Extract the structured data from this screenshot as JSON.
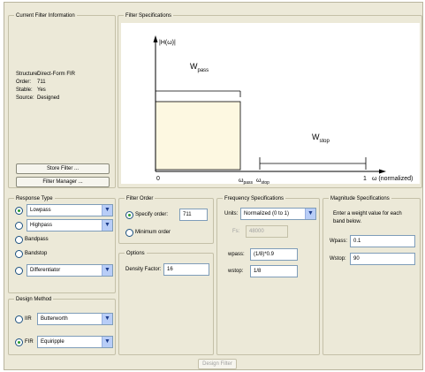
{
  "current_filter": {
    "legend": "Current Filter Information",
    "rows": [
      {
        "label": "Structure:",
        "value": "Direct-Form FIR"
      },
      {
        "label": "Order:",
        "value": "711"
      },
      {
        "label": "Stable:",
        "value": "Yes"
      },
      {
        "label": "Source:",
        "value": "Designed"
      }
    ],
    "store_button": "Store Filter ...",
    "manager_button": "Filter Manager ..."
  },
  "filter_specs": {
    "legend": "Filter Specifications",
    "y_label": "|H(ω)|",
    "wpass_label": "W",
    "wpass_sub": "pass",
    "wstop_label": "W",
    "wstop_sub": "stop",
    "tick_zero": "0",
    "tick_pass": "ω",
    "tick_pass_sub": "pass",
    "tick_stop": "ω",
    "tick_stop_sub": "stop",
    "tick_one": "1",
    "x_label": "ω (normalized)"
  },
  "response_type": {
    "legend": "Response Type",
    "options": [
      {
        "label": "Lowpass",
        "dropdown": true,
        "selected": true
      },
      {
        "label": "Highpass",
        "dropdown": true,
        "selected": false
      },
      {
        "label": "Bandpass",
        "dropdown": false,
        "selected": false
      },
      {
        "label": "Bandstop",
        "dropdown": false,
        "selected": false
      },
      {
        "label": "Differentiator",
        "dropdown": true,
        "selected": false
      }
    ]
  },
  "design_method": {
    "legend": "Design Method",
    "iir_label": "IIR",
    "iir_value": "Butterworth",
    "fir_label": "FIR",
    "fir_value": "Equiripple"
  },
  "filter_order": {
    "legend": "Filter Order",
    "specify_label": "Specify order:",
    "specify_value": "711",
    "minimum_label": "Minimum order"
  },
  "options": {
    "legend": "Options",
    "density_label": "Density Factor:",
    "density_value": "16"
  },
  "frequency_specs": {
    "legend": "Frequency Specifications",
    "units_label": "Units:",
    "units_value": "Normalized (0 to 1)",
    "fs_label": "Fs:",
    "fs_value": "48000",
    "wpass_label": "wpass:",
    "wpass_value": "(1/8)*0.9",
    "wstop_label": "wstop:",
    "wstop_value": "1/8"
  },
  "magnitude_specs": {
    "legend": "Magnitude Specifications",
    "hint": "Enter a weight value for each band below.",
    "wpass_label": "Wpass:",
    "wpass_value": "0.1",
    "wstop_label": "Wstop:",
    "wstop_value": "90"
  },
  "design_button": "Design Filter",
  "colors": {
    "panel": "#ece9d8",
    "passband_fill": "#fdf8e1",
    "radio_selected": "#2a9c2a",
    "dropdown_arrow": "#b8cdf7"
  }
}
